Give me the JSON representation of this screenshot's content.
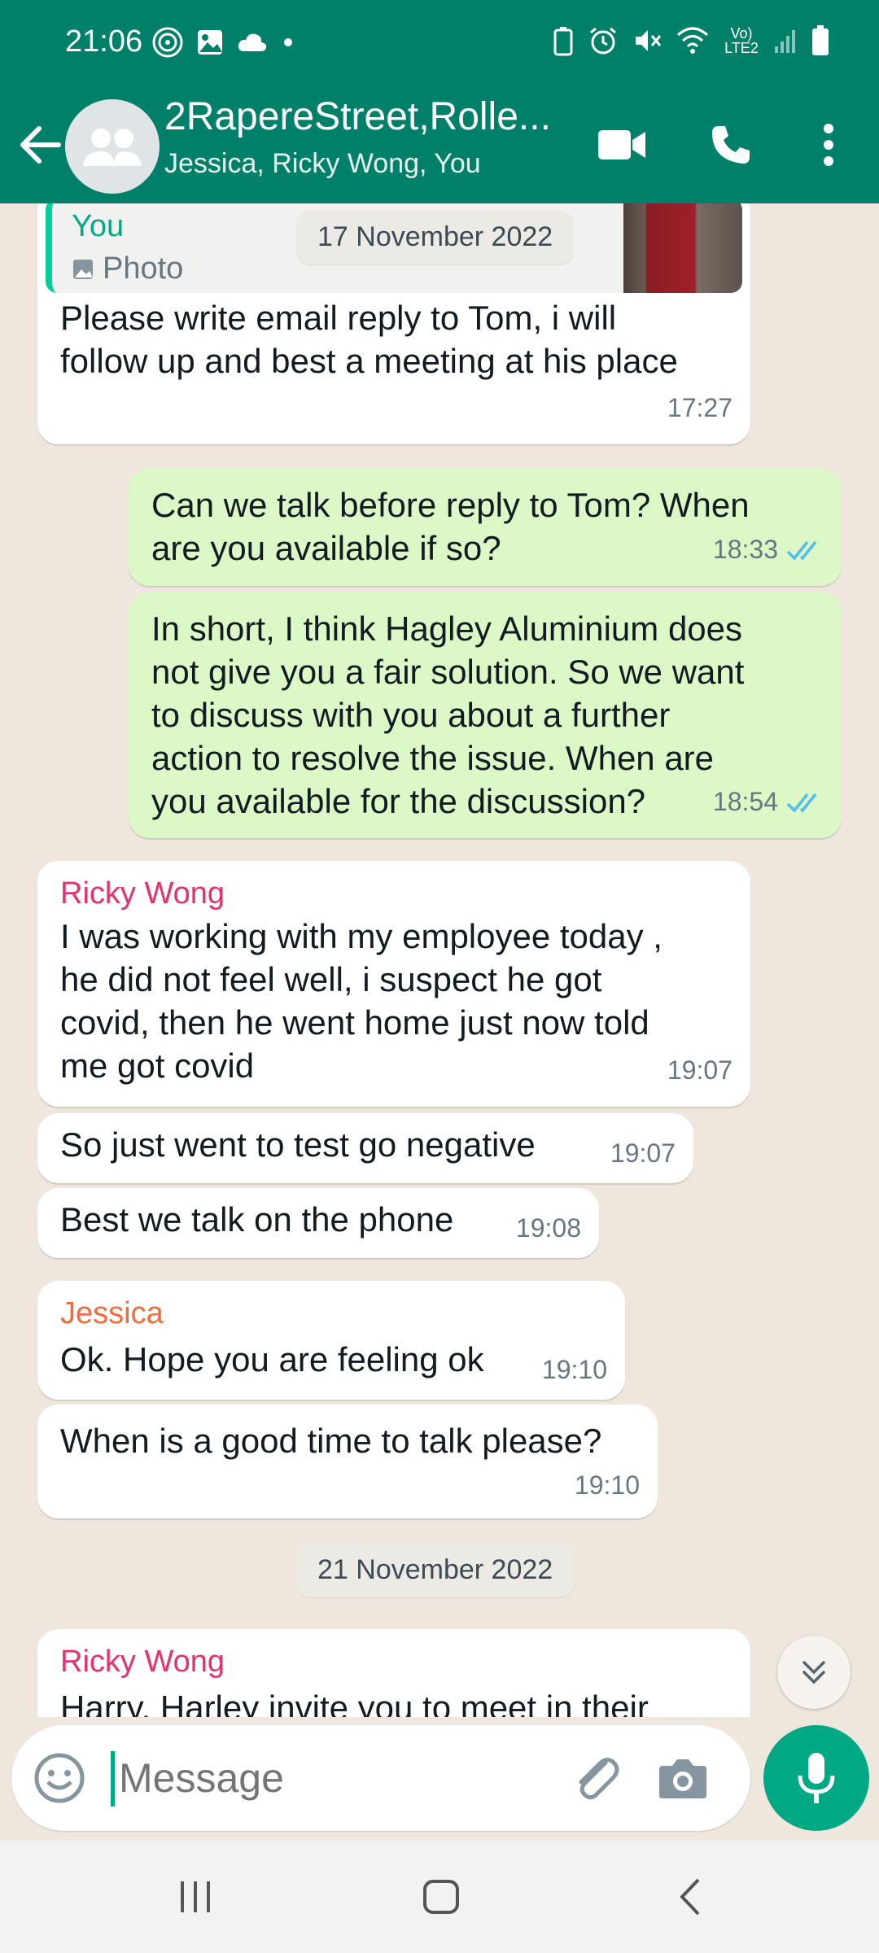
{
  "status_bar": {
    "time": "21:06",
    "network": "Vo) LTE2"
  },
  "header": {
    "title": "2RapereStreet,Rolle...",
    "subtitle": "Jessica, Ricky Wong, You"
  },
  "chat": {
    "reply_preview": {
      "sender": "You",
      "type": "Photo"
    },
    "date_chip_1": "17 November 2022",
    "date_chip_2": "21 November 2022",
    "messages": [
      {
        "sender": "",
        "lines": [
          "Please write email reply to Tom, i will",
          "follow up and best a meeting at his place"
        ],
        "time": "17:27"
      },
      {
        "sender": "",
        "lines": [
          "Can we talk before reply to Tom? When",
          "are you available if so?"
        ],
        "time": "18:33"
      },
      {
        "sender": "",
        "lines": [
          "In short, I think Hagley Aluminium does",
          "not give you a fair solution. So we want",
          "to discuss with you about a further",
          "action to resolve the issue. When are",
          "you available for the discussion?"
        ],
        "time": "18:54"
      },
      {
        "sender": "Ricky Wong",
        "lines": [
          "I was working with my employee today ,",
          "he did not feel well, i suspect he got",
          "covid, then he went home just now told",
          "me got covid"
        ],
        "time": "19:07"
      },
      {
        "sender": "",
        "lines": [
          "So just went to test go negative"
        ],
        "time": "19:07"
      },
      {
        "sender": "",
        "lines": [
          "Best we talk on the phone"
        ],
        "time": "19:08"
      },
      {
        "sender": "Jessica",
        "lines": [
          "Ok. Hope you are feeling ok"
        ],
        "time": "19:10"
      },
      {
        "sender": "",
        "lines": [
          "When is a good time to talk please?"
        ],
        "time": "19:10"
      },
      {
        "sender": "Ricky Wong",
        "lines": [
          "Harry, Harley invite you to meet in their"
        ],
        "time": ""
      }
    ]
  },
  "input": {
    "placeholder": "Message"
  },
  "colors": {
    "brand": "#008069",
    "accent": "#00a884",
    "ricky": "#e5326e",
    "jessica": "#f26b3a",
    "read_ticks": "#53bdeb"
  }
}
